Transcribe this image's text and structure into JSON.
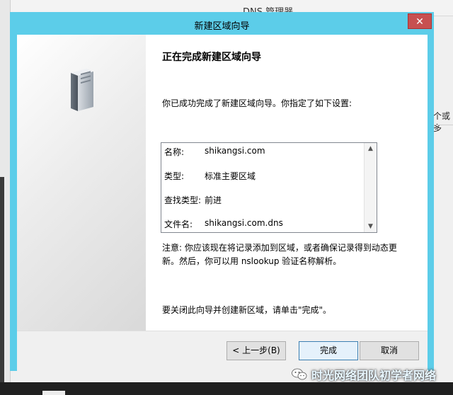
{
  "background_window": {
    "title": "DNS 管理器",
    "right_fragment": "个或多"
  },
  "dialog": {
    "title": "新建区域向导",
    "close_glyph": "✕",
    "heading": "正在完成新建区域向导",
    "intro": "你已成功完成了新建区域向导。你指定了如下设置:",
    "summary": [
      {
        "label": "名称:",
        "value": "shikangsi.com"
      },
      {
        "label": "类型:",
        "value": "标准主要区域"
      },
      {
        "label": "查找类型:",
        "value": "前进"
      },
      {
        "label": "文件名:",
        "value": "shikangsi.com.dns"
      }
    ],
    "note_line1": "注意: 你应该现在将记录添加到区域，或者确保记录得到动态更",
    "note_line2": "新。然后，你可以用 nslookup 验证名称解析。",
    "finish_instruction": "要关闭此向导并创建新区域，请单击\"完成\"。",
    "buttons": {
      "back": "< 上一步(B)",
      "finish": "完成",
      "cancel": "取消"
    }
  },
  "watermark": {
    "text": "时光网络团队初学者网络"
  },
  "icons": {
    "server": "server-icon",
    "scroll_up": "▲",
    "scroll_down": "▼"
  }
}
